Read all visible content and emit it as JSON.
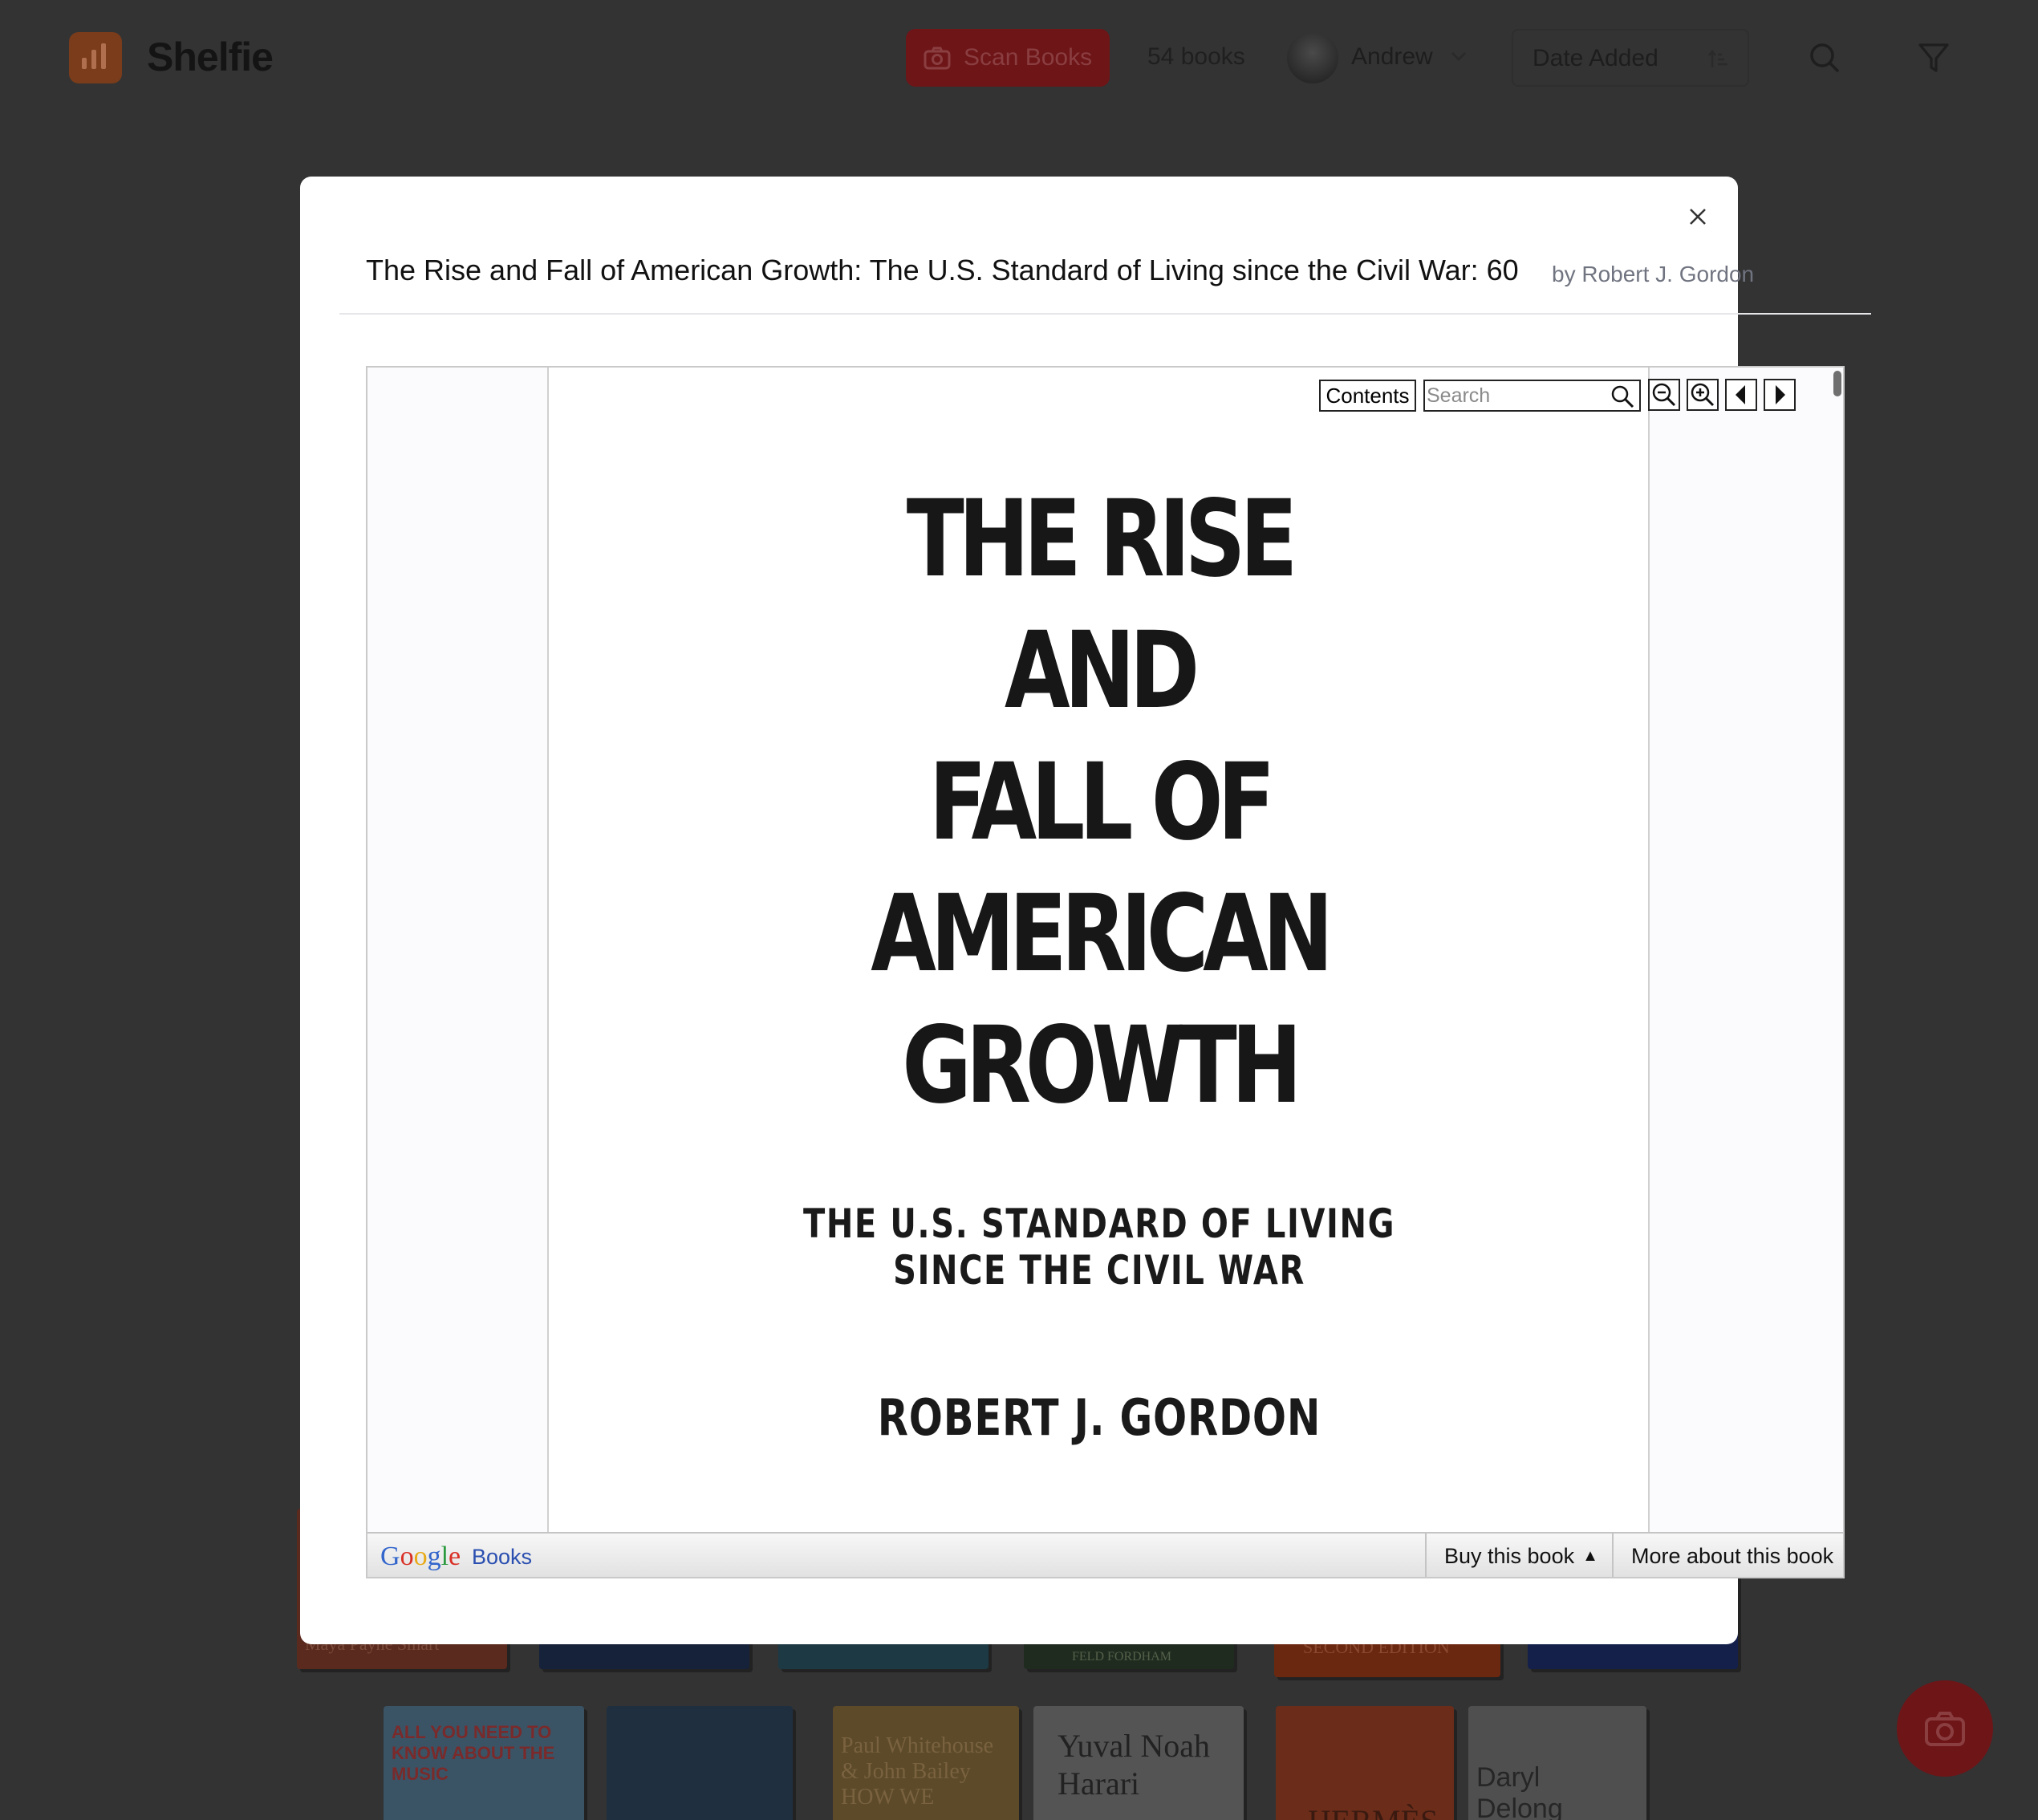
{
  "app": {
    "name": "Shelfie",
    "scan_button_label": "Scan Books",
    "book_count": "54 books",
    "user_name": "Andrew",
    "sort_label": "Date Added"
  },
  "modal": {
    "book_title": "The Rise and Fall of American Growth: The U.S. Standard of Living since the Civil War: 60",
    "book_author": "by Robert J. Gordon"
  },
  "viewer": {
    "contents_label": "Contents",
    "search_placeholder": "Search",
    "cover": {
      "title_lines": [
        "THE RISE",
        "AND",
        "FALL OF",
        "AMERICAN",
        "GROWTH"
      ],
      "subtitle_lines": [
        "THE U.S. STANDARD OF LIVING",
        "SINCE THE CIVIL WAR"
      ],
      "author": "ROBERT J. GORDON"
    },
    "footer": {
      "logo_text": "Google",
      "books_label": "Books",
      "buy_label": "Buy this book",
      "buy_arrow": "▲",
      "more_label": "More about this book"
    }
  },
  "background_books": [
    {
      "text": "Maya Payne Smart",
      "color": "#5a2a1e"
    },
    {
      "text": "",
      "color": "#16213a"
    },
    {
      "text": "",
      "color": "#1d3a44"
    },
    {
      "text": "FELD FORDHAM",
      "color": "#1f2b1f"
    },
    {
      "text": "SECOND EDITION",
      "color": "#6a2810"
    },
    {
      "text": "",
      "color": "#14204a"
    },
    {
      "text": "ALL YOU NEED TO KNOW ABOUT THE MUSIC",
      "color": "#3a5466"
    },
    {
      "text": "",
      "color": "#1f2f3f"
    },
    {
      "text": "Paul Whitehouse & John Bailey HOW WE",
      "color": "#5c4a28"
    },
    {
      "text": "Yuval Noah Harari",
      "color": "#545454"
    },
    {
      "text": "HERMÈS",
      "color": "#6b2c1a"
    },
    {
      "text": "Daryl Delong Michael",
      "color": "#4f4f4f"
    }
  ],
  "colors": {
    "overlay": "#333333",
    "accent": "#6e1518",
    "modal_bg": "#ffffff",
    "author_text": "#707480"
  }
}
